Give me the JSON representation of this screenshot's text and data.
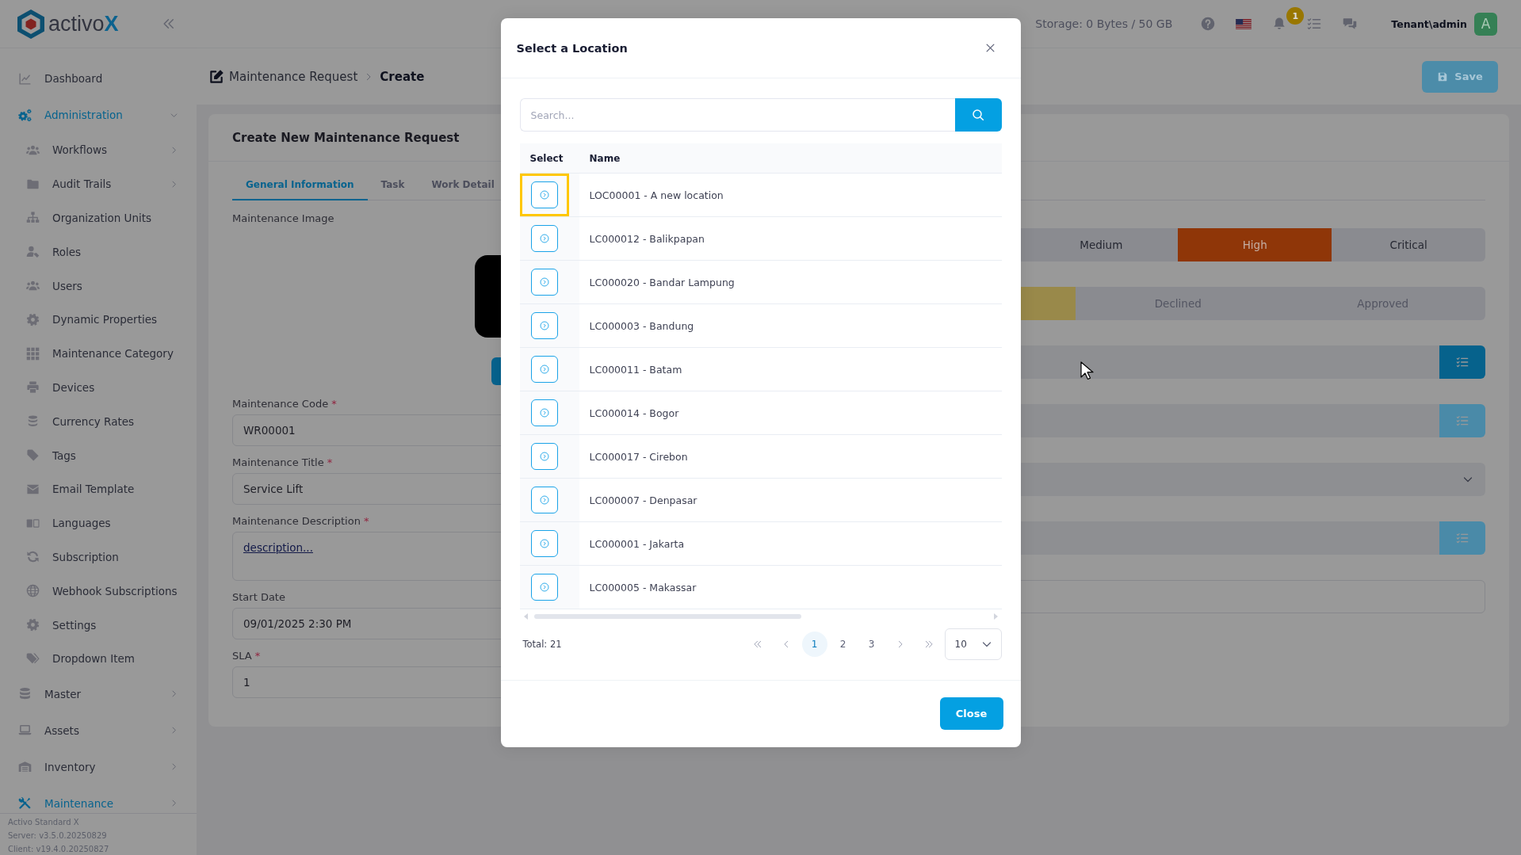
{
  "sidebar": {
    "logo": "activo**X**",
    "items": [
      {
        "label": "Dashboard",
        "selected": false,
        "has_children": false
      },
      {
        "label": "Administration",
        "selected": true,
        "has_children": true,
        "expanded": true,
        "children": [
          {
            "label": "Workflows",
            "selected": false,
            "has_children": true,
            "expanded": false
          },
          {
            "label": "Audit Trails",
            "selected": false,
            "has_children": true,
            "expanded": false
          },
          {
            "label": "Organization Units",
            "selected": false,
            "has_children": false
          },
          {
            "label": "Roles",
            "selected": false,
            "has_children": false
          },
          {
            "label": "Users",
            "selected": false,
            "has_children": false
          },
          {
            "label": "Dynamic Properties",
            "selected": false,
            "has_children": false
          },
          {
            "label": "Maintenance Category",
            "selected": false,
            "has_children": false
          },
          {
            "label": "Devices",
            "selected": false,
            "has_children": false
          },
          {
            "label": "Currency Rates",
            "selected": false,
            "has_children": false
          },
          {
            "label": "Tags",
            "selected": false,
            "has_children": false
          },
          {
            "label": "Email Template",
            "selected": false,
            "has_children": false
          },
          {
            "label": "Languages",
            "selected": false,
            "has_children": false
          },
          {
            "label": "Subscription",
            "selected": false,
            "has_children": false
          },
          {
            "label": "Webhook Subscriptions",
            "selected": false,
            "has_children": false
          },
          {
            "label": "Settings",
            "selected": false,
            "has_children": false
          },
          {
            "label": "Dropdown Item",
            "selected": false,
            "has_children": false
          }
        ]
      },
      {
        "label": "Master",
        "selected": false,
        "has_children": true,
        "expanded": false
      },
      {
        "label": "Assets",
        "selected": false,
        "has_children": true,
        "expanded": false
      },
      {
        "label": "Inventory",
        "selected": false,
        "has_children": true,
        "expanded": false
      },
      {
        "label": "Maintenance",
        "selected": true,
        "has_children": true,
        "expanded": false
      }
    ],
    "footer": [
      "Activo Standard X",
      "Server: v3.5.0.20250829",
      "Client: v19.4.0.20250827"
    ]
  },
  "topbar": {
    "storage": "Storage: 0 Bytes / 50 GB",
    "notification_count": "1",
    "user": "Tenant\\admin",
    "avatar": "A"
  },
  "breadcrumb": [
    "Maintenance Request",
    "Create"
  ],
  "save_button": {
    "label": "Save",
    "disabled": true
  },
  "form": {
    "title": "Create New Maintenance Request",
    "tabs": [
      {
        "label": "General Information",
        "selected": true
      },
      {
        "label": "Task",
        "selected": false
      },
      {
        "label": "Work Detail",
        "selected": false
      }
    ],
    "image_label": "Maintenance Image",
    "fields": [
      {
        "kind": "input",
        "label": "Maintenance Code",
        "required_mark": "*",
        "value": "WR00001"
      },
      {
        "kind": "input",
        "label": "Maintenance Title",
        "required_mark": "*",
        "value": "Service Lift"
      },
      {
        "kind": "textarea",
        "label": "Maintenance Description",
        "required_mark": "*",
        "value": "description..."
      },
      {
        "kind": "input",
        "label": "Start Date",
        "value": "09/01/2025 2:30 PM"
      },
      {
        "kind": "input",
        "label": "SLA",
        "required_mark": "*",
        "value": "1"
      }
    ],
    "side_fields": [
      {
        "kind": "segments",
        "disabled": false,
        "options": [
          {
            "selected": false
          },
          {
            "label": "Medium",
            "selected": false
          },
          {
            "label": "High",
            "selected": true,
            "color": "#8f3608"
          },
          {
            "label": "Critical",
            "selected": false
          }
        ]
      },
      {
        "kind": "segments",
        "disabled": true,
        "options": [
          {
            "selected": true,
            "color": "#99894a"
          },
          {
            "label": "Declined",
            "selected": false
          },
          {
            "label": "Approved",
            "selected": false
          }
        ]
      },
      {
        "kind": "picker",
        "disabled": false
      },
      {
        "kind": "picker",
        "disabled": true
      },
      {
        "kind": "select"
      },
      {
        "kind": "picker",
        "disabled": true
      },
      {
        "kind": "input"
      }
    ]
  },
  "modal": {
    "title": "Select a Location",
    "search": {
      "placeholder": "Search..."
    },
    "columns": [
      "Select",
      "Name"
    ],
    "rows": [
      {
        "name": "LOC00001 - A new location",
        "focused": true
      },
      {
        "name": "LC000012 - Balikpapan",
        "focused": false
      },
      {
        "name": "LC000020 - Bandar Lampung",
        "focused": false
      },
      {
        "name": "LC000003 - Bandung",
        "focused": false
      },
      {
        "name": "LC000011 - Batam",
        "focused": false
      },
      {
        "name": "LC000014 - Bogor",
        "focused": false
      },
      {
        "name": "LC000017 - Cirebon",
        "focused": false
      },
      {
        "name": "LC000007 - Denpasar",
        "focused": false
      },
      {
        "name": "LC000001 - Jakarta",
        "focused": false
      },
      {
        "name": "LC000005 - Makassar",
        "focused": false
      }
    ],
    "total": "Total: 21",
    "pages": [
      {
        "label": "1",
        "selected": true
      },
      {
        "label": "2",
        "selected": false
      },
      {
        "label": "3",
        "selected": false
      }
    ],
    "page_size": "10",
    "close_button": "Close"
  }
}
